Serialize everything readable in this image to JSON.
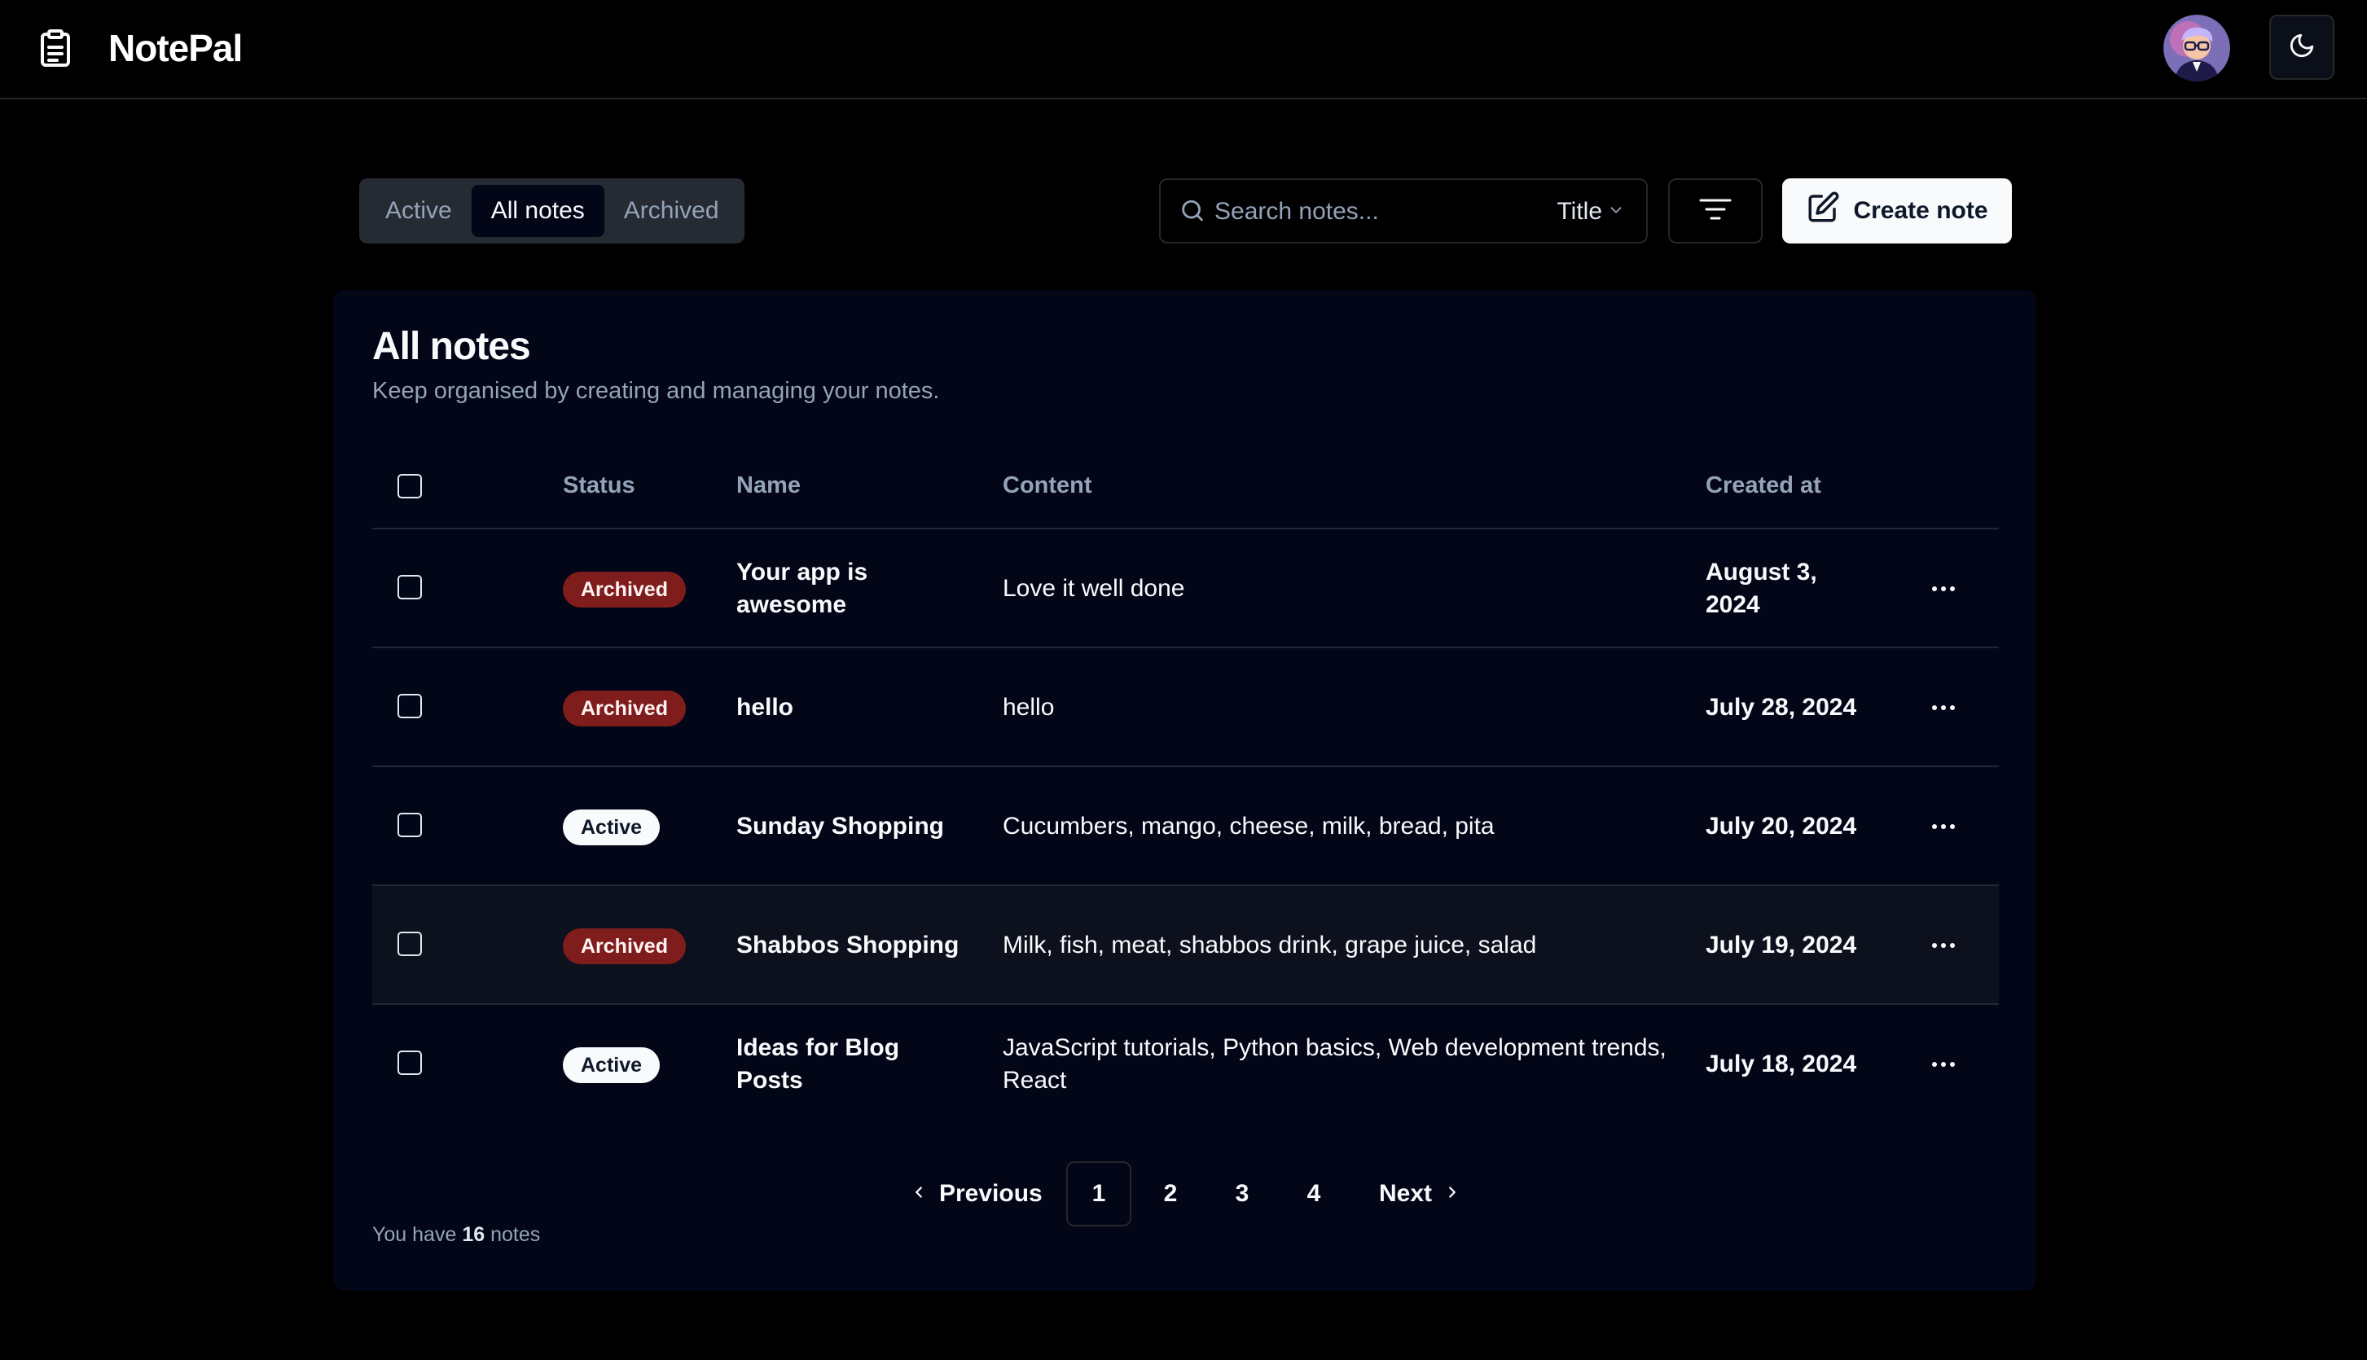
{
  "header": {
    "app_name": "NotePal",
    "logo_icon": "clipboard-icon",
    "theme_icon": "moon-icon"
  },
  "toolbar": {
    "tabs": [
      {
        "label": "Active",
        "selected": false
      },
      {
        "label": "All notes",
        "selected": true
      },
      {
        "label": "Archived",
        "selected": false
      }
    ],
    "search": {
      "placeholder": "Search notes...",
      "value": ""
    },
    "search_field": "Title",
    "create_label": "Create note"
  },
  "card": {
    "title": "All notes",
    "description": "Keep organised by creating and managing your notes."
  },
  "table": {
    "columns": {
      "status": "Status",
      "name": "Name",
      "content": "Content",
      "created": "Created at"
    },
    "rows": [
      {
        "status": "Archived",
        "name": "Your app is awesome",
        "content": "Love it well done",
        "created": "August 3, 2024"
      },
      {
        "status": "Archived",
        "name": "hello",
        "content": "hello",
        "created": "July 28, 2024"
      },
      {
        "status": "Active",
        "name": "Sunday Shopping",
        "content": "Cucumbers, mango, cheese, milk, bread, pita",
        "created": "July 20, 2024"
      },
      {
        "status": "Archived",
        "name": "Shabbos Shopping",
        "content": "Milk, fish, meat, shabbos drink, grape juice, salad",
        "created": "July 19, 2024"
      },
      {
        "status": "Active",
        "name": "Ideas for Blog Posts",
        "content": "JavaScript tutorials, Python basics, Web development trends, React",
        "created": "July 18, 2024"
      }
    ]
  },
  "pagination": {
    "previous": "Previous",
    "pages": [
      "1",
      "2",
      "3",
      "4"
    ],
    "current": "1",
    "next": "Next"
  },
  "footer": {
    "prefix": "You have",
    "count": "16",
    "suffix": "notes"
  },
  "colors": {
    "background": "#000000",
    "card": "#020617",
    "archived_badge": "#7f1d1d",
    "active_badge": "#f8fafc"
  }
}
